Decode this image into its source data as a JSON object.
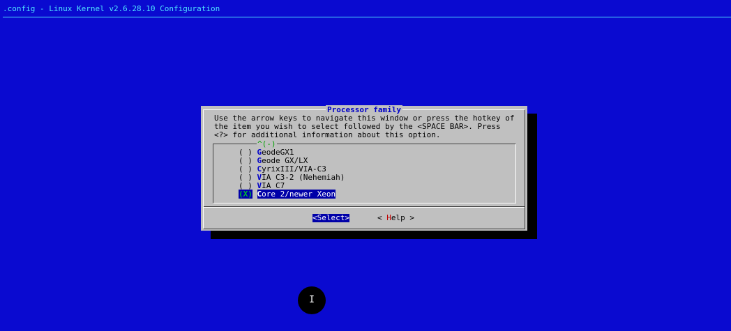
{
  "titlebar": {
    "text": ".config - Linux Kernel v2.6.28.10 Configuration"
  },
  "dialog": {
    "title": "Processor family",
    "help_lines": [
      "Use the arrow keys to navigate this window or press the hotkey of",
      "the item you wish to select followed by the <SPACE BAR>. Press",
      "<?> for additional information about this option."
    ],
    "scroll_indicator": "^(-)",
    "options": [
      {
        "mark": "( )",
        "hotkey": "G",
        "rest": "eodeGX1"
      },
      {
        "mark": "( )",
        "hotkey": "G",
        "rest": "eode GX/LX"
      },
      {
        "mark": "( )",
        "hotkey": "C",
        "rest": "yrixIII/VIA-C3"
      },
      {
        "mark": "( )",
        "hotkey": "V",
        "rest": "IA C3-2 (Nehemiah)"
      },
      {
        "mark": "( )",
        "hotkey": "V",
        "rest": "IA C7"
      },
      {
        "mark": "(X)",
        "hotkey": "C",
        "rest": "ore 2/newer Xeon"
      }
    ],
    "buttons": {
      "select": "<Select>",
      "help_prefix": "< ",
      "help_hotkey": "H",
      "help_rest": "elp >"
    }
  },
  "colors": {
    "background": "#0a0ad0",
    "dialog": "#c0c0c0",
    "highlight": "#0000a8",
    "title_text": "#4fe3ff"
  },
  "icons": {
    "cursor": "text-cursor-icon"
  }
}
